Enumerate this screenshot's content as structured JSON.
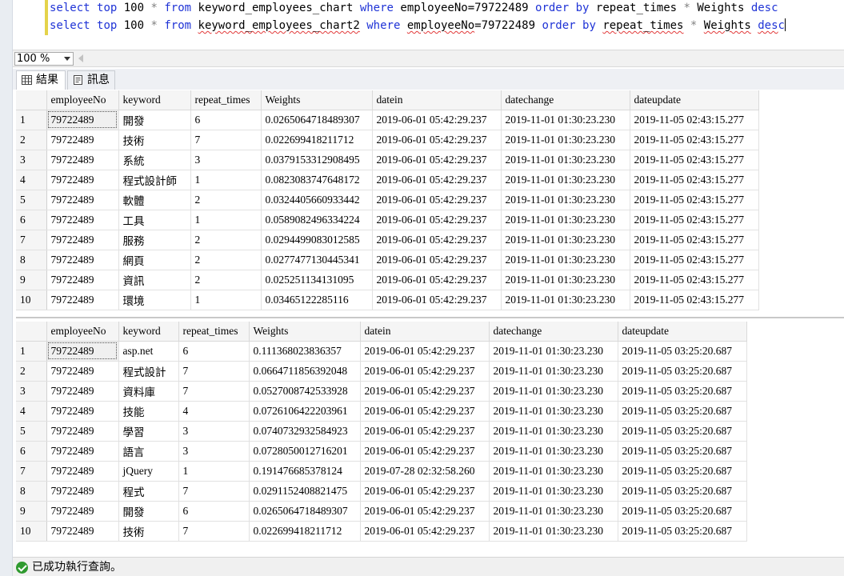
{
  "editor": {
    "line1": {
      "kw1": "select",
      "kw2": "top",
      "num": "100",
      "star": "*",
      "kw3": "from",
      "table": "keyword_employees_chart",
      "kw4": "where",
      "cond": "employeeNo=79722489",
      "kw5": "order",
      "kw6": "by",
      "col": "repeat_times",
      "op": "*",
      "col2": "Weights",
      "kw7": "desc"
    },
    "line2": {
      "kw1": "select",
      "kw2": "top",
      "num": "100",
      "star": "*",
      "kw3": "from",
      "table": "keyword_employees_chart2",
      "kw4": "where",
      "cond_a": "employeeNo",
      "cond_b": "=79722489",
      "kw5": "order",
      "kw6": "by",
      "col": "repeat_times",
      "op": "*",
      "col2": "Weights",
      "kw7a": "des",
      "kw7b": "c"
    }
  },
  "zoom": {
    "value": "100 %"
  },
  "tabs": {
    "results": "結果",
    "messages": "訊息"
  },
  "grid1": {
    "columns": [
      "employeeNo",
      "keyword",
      "repeat_times",
      "Weights",
      "datein",
      "datechange",
      "dateupdate"
    ],
    "rows": [
      [
        "1",
        "79722489",
        "開發",
        "6",
        "0.0265064718489307",
        "2019-06-01 05:42:29.237",
        "2019-11-01 01:30:23.230",
        "2019-11-05 02:43:15.277"
      ],
      [
        "2",
        "79722489",
        "技術",
        "7",
        "0.022699418211712",
        "2019-06-01 05:42:29.237",
        "2019-11-01 01:30:23.230",
        "2019-11-05 02:43:15.277"
      ],
      [
        "3",
        "79722489",
        "系統",
        "3",
        "0.0379153312908495",
        "2019-06-01 05:42:29.237",
        "2019-11-01 01:30:23.230",
        "2019-11-05 02:43:15.277"
      ],
      [
        "4",
        "79722489",
        "程式設計師",
        "1",
        "0.0823083747648172",
        "2019-06-01 05:42:29.237",
        "2019-11-01 01:30:23.230",
        "2019-11-05 02:43:15.277"
      ],
      [
        "5",
        "79722489",
        "軟體",
        "2",
        "0.0324405660933442",
        "2019-06-01 05:42:29.237",
        "2019-11-01 01:30:23.230",
        "2019-11-05 02:43:15.277"
      ],
      [
        "6",
        "79722489",
        "工具",
        "1",
        "0.0589082496334224",
        "2019-06-01 05:42:29.237",
        "2019-11-01 01:30:23.230",
        "2019-11-05 02:43:15.277"
      ],
      [
        "7",
        "79722489",
        "服務",
        "2",
        "0.0294499083012585",
        "2019-06-01 05:42:29.237",
        "2019-11-01 01:30:23.230",
        "2019-11-05 02:43:15.277"
      ],
      [
        "8",
        "79722489",
        "網頁",
        "2",
        "0.0277477130445341",
        "2019-06-01 05:42:29.237",
        "2019-11-01 01:30:23.230",
        "2019-11-05 02:43:15.277"
      ],
      [
        "9",
        "79722489",
        "資訊",
        "2",
        "0.025251134131095",
        "2019-06-01 05:42:29.237",
        "2019-11-01 01:30:23.230",
        "2019-11-05 02:43:15.277"
      ],
      [
        "10",
        "79722489",
        "環境",
        "1",
        "0.03465122285116",
        "2019-06-01 05:42:29.237",
        "2019-11-01 01:30:23.230",
        "2019-11-05 02:43:15.277"
      ]
    ]
  },
  "grid2": {
    "columns": [
      "employeeNo",
      "keyword",
      "repeat_times",
      "Weights",
      "datein",
      "datechange",
      "dateupdate"
    ],
    "rows": [
      [
        "1",
        "79722489",
        "asp.net",
        "6",
        "0.111368023836357",
        "2019-06-01 05:42:29.237",
        "2019-11-01 01:30:23.230",
        "2019-11-05 03:25:20.687"
      ],
      [
        "2",
        "79722489",
        "程式設計",
        "7",
        "0.0664711856392048",
        "2019-06-01 05:42:29.237",
        "2019-11-01 01:30:23.230",
        "2019-11-05 03:25:20.687"
      ],
      [
        "3",
        "79722489",
        "資料庫",
        "7",
        "0.0527008742533928",
        "2019-06-01 05:42:29.237",
        "2019-11-01 01:30:23.230",
        "2019-11-05 03:25:20.687"
      ],
      [
        "4",
        "79722489",
        "技能",
        "4",
        "0.0726106422203961",
        "2019-06-01 05:42:29.237",
        "2019-11-01 01:30:23.230",
        "2019-11-05 03:25:20.687"
      ],
      [
        "5",
        "79722489",
        "學習",
        "3",
        "0.0740732932584923",
        "2019-06-01 05:42:29.237",
        "2019-11-01 01:30:23.230",
        "2019-11-05 03:25:20.687"
      ],
      [
        "6",
        "79722489",
        "語言",
        "3",
        "0.0728050012716201",
        "2019-06-01 05:42:29.237",
        "2019-11-01 01:30:23.230",
        "2019-11-05 03:25:20.687"
      ],
      [
        "7",
        "79722489",
        "jQuery",
        "1",
        "0.191476685378124",
        "2019-07-28 02:32:58.260",
        "2019-11-01 01:30:23.230",
        "2019-11-05 03:25:20.687"
      ],
      [
        "8",
        "79722489",
        "程式",
        "7",
        "0.0291152408821475",
        "2019-06-01 05:42:29.237",
        "2019-11-01 01:30:23.230",
        "2019-11-05 03:25:20.687"
      ],
      [
        "9",
        "79722489",
        "開發",
        "6",
        "0.0265064718489307",
        "2019-06-01 05:42:29.237",
        "2019-11-01 01:30:23.230",
        "2019-11-05 03:25:20.687"
      ],
      [
        "10",
        "79722489",
        "技術",
        "7",
        "0.022699418211712",
        "2019-06-01 05:42:29.237",
        "2019-11-01 01:30:23.230",
        "2019-11-05 03:25:20.687"
      ]
    ]
  },
  "status": {
    "text": "已成功執行查詢。"
  }
}
